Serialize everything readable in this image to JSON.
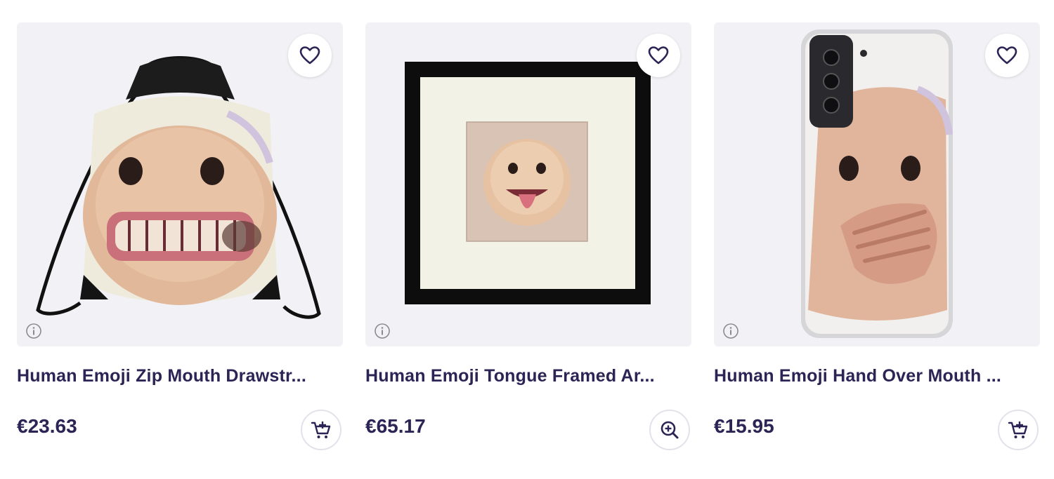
{
  "products": [
    {
      "title": "Human Emoji Zip Mouth Drawstr...",
      "price": "€23.63",
      "image": "drawstring-bag-with-face",
      "action_icon": "add-to-cart-icon",
      "favorite_icon": "heart-icon"
    },
    {
      "title": "Human Emoji Tongue Framed Ar...",
      "price": "€65.17",
      "image": "framed-art-print-with-face",
      "action_icon": "zoom-in-icon",
      "favorite_icon": "heart-icon"
    },
    {
      "title": "Human Emoji Hand Over Mouth ...",
      "price": "€15.95",
      "image": "phone-case-with-face",
      "action_icon": "add-to-cart-icon",
      "favorite_icon": "heart-icon"
    }
  ],
  "colors": {
    "text": "#2b2454",
    "tile_bg": "#f2f2f6",
    "button_border": "#e3e2ea"
  }
}
